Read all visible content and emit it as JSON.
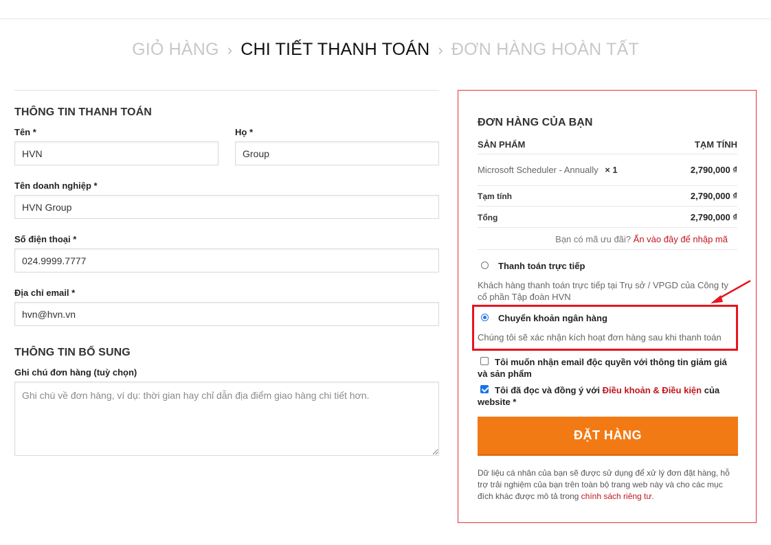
{
  "steps": {
    "cart": "GIỎ HÀNG",
    "sep1": "›",
    "checkout": "CHI TIẾT THANH TOÁN",
    "sep2": "›",
    "done": "ĐƠN HÀNG HOÀN TẤT"
  },
  "billing": {
    "title": "THÔNG TIN THANH TOÁN",
    "first_name_label": "Tên *",
    "first_name_value": "HVN",
    "last_name_label": "Họ *",
    "last_name_value": "Group",
    "company_label": "Tên doanh nghiệp *",
    "company_value": "HVN Group",
    "phone_label": "Số điện thoại *",
    "phone_value": "024.9999.7777",
    "email_label": "Địa chỉ email *",
    "email_value": "hvn@hvn.vn"
  },
  "additional": {
    "title": "THÔNG TIN BỔ SUNG",
    "notes_label": "Ghi chú đơn hàng (tuỳ chọn)",
    "notes_placeholder": "Ghi chú về đơn hàng, ví dụ: thời gian hay chỉ dẫn địa điểm giao hàng chi tiết hơn."
  },
  "order": {
    "title": "ĐƠN HÀNG CỦA BẠN",
    "col_product": "SẢN PHẨM",
    "col_subtotal": "TẠM TÍNH",
    "item_name": "Microsoft Scheduler - Annually",
    "item_qty": "× 1",
    "item_price": "2,790,000 ₫",
    "subtotal_label": "Tạm tính",
    "subtotal_value": "2,790,000 ₫",
    "total_label": "Tổng",
    "total_value": "2,790,000 ₫",
    "coupon_text": "Bạn có mã ưu đãi?",
    "coupon_link": "Ấn vào đây để nhập mã",
    "pay_direct_label": "Thanh toán trực tiếp",
    "pay_direct_desc": "Khách hàng thanh toán trực tiếp tại Trụ sở / VPGD của Công ty cổ phần Tập đoàn HVN",
    "pay_bank_label": "Chuyển khoản ngân hàng",
    "pay_bank_desc": "Chúng tôi sẽ xác nhận kích hoạt đơn hàng sau khi thanh toán",
    "newsletter_label": "Tôi muốn nhận email độc quyền với thông tin giảm giá và sản phẩm",
    "terms_prefix": "Tôi đã đọc và đồng ý với",
    "terms_link": "Điều khoản & Điều kiện",
    "terms_suffix": "của website *",
    "place_order": "ĐẶT HÀNG",
    "privacy_text": "Dữ liệu cá nhân của bạn sẽ được sử dụng để xử lý đơn đặt hàng, hỗ trợ trải nghiệm của bạn trên toàn bộ trang web này và cho các mục đích khác được mô tả trong",
    "privacy_link": "chính sách riêng tư",
    "privacy_end": "."
  },
  "colors": {
    "accent": "#f27a14",
    "border_red": "#e0343a",
    "link_red": "#c0161c",
    "annotation_red": "#e8141f"
  }
}
